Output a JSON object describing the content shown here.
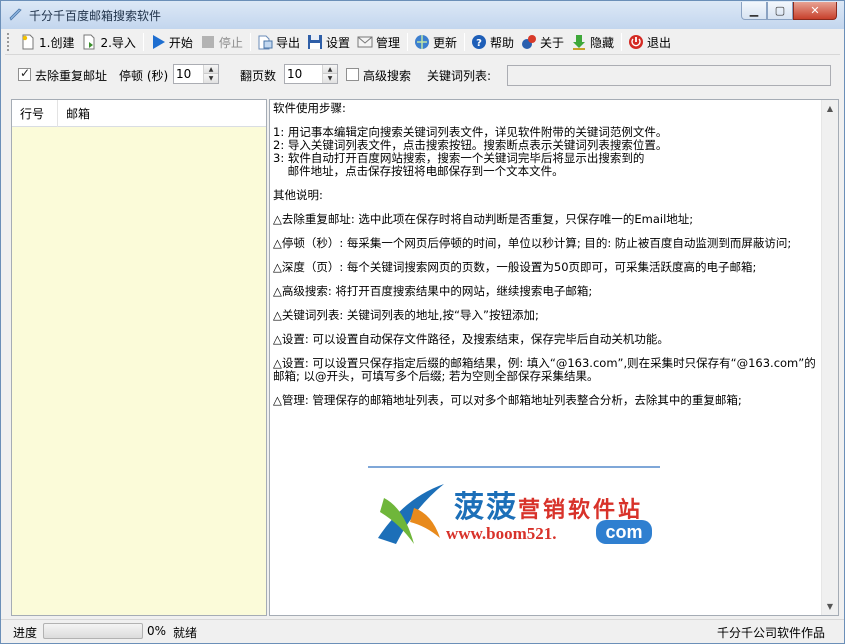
{
  "window": {
    "title": "千分千百度邮箱搜索软件"
  },
  "toolbar": {
    "items": [
      {
        "label": "1.创建",
        "icon": "new-document-icon",
        "enabled": true
      },
      {
        "label": "2.导入",
        "icon": "import-icon",
        "enabled": true
      },
      {
        "label": "开始",
        "icon": "play-icon",
        "enabled": true
      },
      {
        "label": "停止",
        "icon": "stop-icon",
        "enabled": false
      },
      {
        "label": "导出",
        "icon": "export-icon",
        "enabled": true
      },
      {
        "label": "设置",
        "icon": "save-disk-icon",
        "enabled": true
      },
      {
        "label": "管理",
        "icon": "mail-icon",
        "enabled": true
      },
      {
        "label": "更新",
        "icon": "update-globe-icon",
        "enabled": true
      },
      {
        "label": "帮助",
        "icon": "help-icon",
        "enabled": true
      },
      {
        "label": "关于",
        "icon": "about-icon",
        "enabled": true
      },
      {
        "label": "隐藏",
        "icon": "hide-down-arrow-icon",
        "enabled": true
      },
      {
        "label": "退出",
        "icon": "exit-power-icon",
        "enabled": true
      }
    ]
  },
  "options": {
    "dedupe_label": "去除重复邮址",
    "dedupe_checked": true,
    "pause_label": "停顿 (秒)",
    "pause_value": "10",
    "pages_label": "翻页数",
    "pages_value": "10",
    "advanced_label": "高级搜索",
    "advanced_checked": false,
    "keywords_label": "关键词列表:",
    "keywords_value": ""
  },
  "list": {
    "columns": [
      "行号",
      "邮箱"
    ]
  },
  "help": {
    "lines": [
      "软件使用步骤:",
      "",
      "1: 用记事本编辑定向搜索关键词列表文件，详见软件附带的关键词范例文件。",
      "2: 导入关键词列表文件，点击搜索按钮。搜索断点表示关键词列表搜索位置。",
      "3: 软件自动打开百度网站搜索，搜索一个关键词完毕后将显示出搜索到的",
      "    邮件地址，点击保存按钮将电邮保存到一个文本文件。",
      "",
      "其他说明:",
      "",
      "△去除重复邮址: 选中此项在保存时将自动判断是否重复，只保存唯一的Email地址;",
      "",
      "△停顿（秒）: 每采集一个网页后停顿的时间，单位以秒计算; 目的: 防止被百度自动监测到而屏蔽访问;",
      "",
      "△深度（页）: 每个关键词搜索网页的页数，一般设置为50页即可，可采集活跃度高的电子邮箱;",
      "",
      "△高级搜索: 将打开百度搜索结果中的网站，继续搜索电子邮箱;",
      "",
      "△关键词列表: 关键词列表的地址,按“导入”按钮添加;",
      "",
      "△设置: 可以设置自动保存文件路径，及搜索结束，保存完毕后自动关机功能。",
      "",
      "△设置: 可以设置只保存指定后缀的邮箱结果，例: 填入“@163.com”,则在采集时只保存有“@163.com”的邮箱; 以@开头，可填写多个后缀; 若为空则全部保存采集结果。",
      "",
      "△管理: 管理保存的邮箱地址列表，可以对多个邮箱地址列表整合分析，去除其中的重复邮箱;"
    ]
  },
  "watermark": {
    "brand_main": "菠菠",
    "brand_sub": "营销软件站",
    "url": "www.boom521.",
    "tld": "com"
  },
  "status": {
    "progress_label": "进度",
    "progress_value": 0,
    "progress_text": "0%",
    "state_text": "就绪",
    "credit": "千分千公司软件作品"
  }
}
